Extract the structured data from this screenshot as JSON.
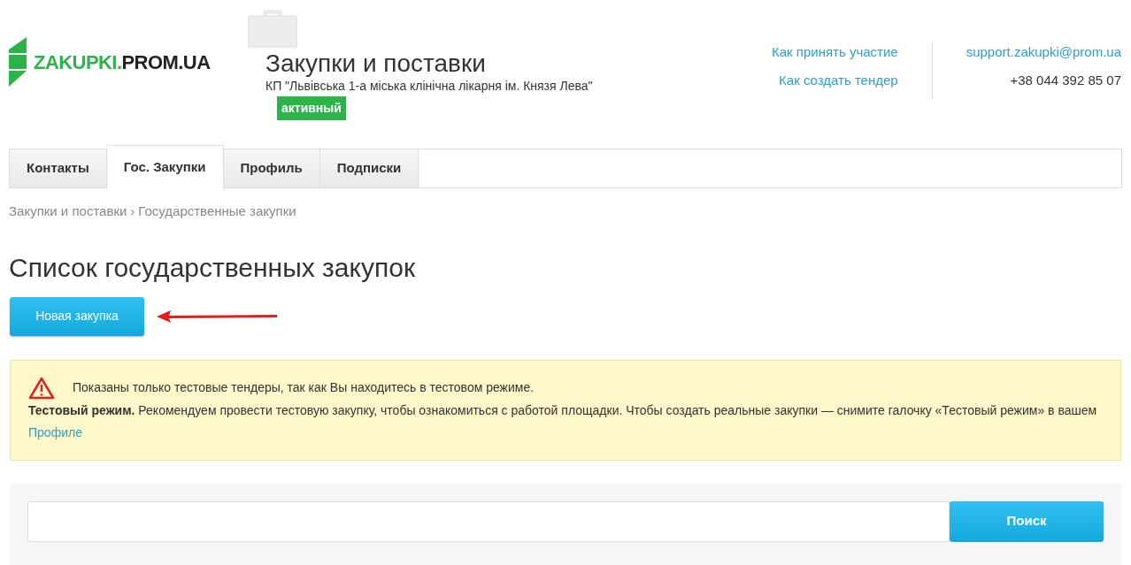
{
  "logo": {
    "accent": "ZAKUPKI.",
    "rest": "PROM.UA"
  },
  "company": {
    "title": "Закупки и поставки",
    "name": "КП \"Львівська 1-а міська клінічна лікарня ім. Князя Лева\"",
    "status": "активный"
  },
  "help_links": [
    "Как принять участие",
    "Как создать тендер"
  ],
  "contact": {
    "email": "support.zakupki@prom.ua",
    "phone": "+38 044 392 85 07"
  },
  "tabs": [
    {
      "label": "Контакты",
      "selected": false
    },
    {
      "label": "Гос. Закупки",
      "selected": true
    },
    {
      "label": "Профиль",
      "selected": false
    },
    {
      "label": "Подписки",
      "selected": false
    }
  ],
  "breadcrumb": [
    "Закупки и поставки",
    "›",
    "Государственные закупки"
  ],
  "heading": "Список государственных закупок",
  "new_button": "Новая закупка",
  "alert": {
    "line": "Показаны только тестовые тендеры, так как Вы находитесь в тестовом режиме.",
    "text": "**Тестовый режим.** Рекомендуем провести тестовую закупку, чтобы ознакомиться с работой площадки. Чтобы создать реальные закупки — снимите галочку «Тестовый режим» в вашем",
    "link": "Профиле"
  },
  "search": {
    "button": "Поиск"
  }
}
